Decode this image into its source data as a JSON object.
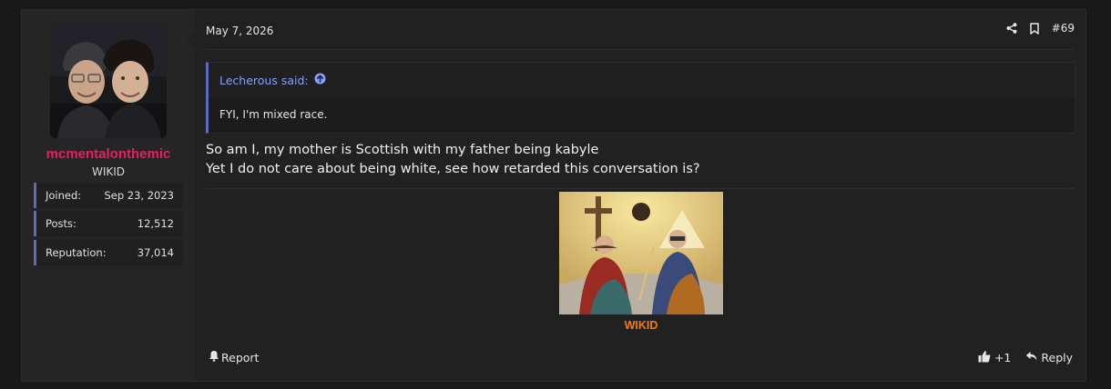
{
  "user": {
    "username": "mcmentalonthemic",
    "title": "WIKID",
    "stats": [
      {
        "label": "Joined:",
        "value": "Sep 23, 2023"
      },
      {
        "label": "Posts:",
        "value": "12,512"
      },
      {
        "label": "Reputation:",
        "value": "37,014"
      }
    ]
  },
  "post": {
    "date": "May 7, 2026",
    "number": "#69",
    "quote": {
      "author_said": "Lecherous said:",
      "text": "FYI, I'm mixed race."
    },
    "message_lines": [
      "So am I, my mother is Scottish with my father being kabyle",
      "Yet I do not care about being white, see how retarded this conversation is?"
    ],
    "signature_text": "WIKID"
  },
  "footer": {
    "report_label": "Report",
    "like_count": "+1",
    "reply_label": "Reply"
  },
  "colors": {
    "username": "#e91e63",
    "accent": "#5c6bc0",
    "signature": "#f57c00",
    "quote_author": "#8c9eff"
  }
}
